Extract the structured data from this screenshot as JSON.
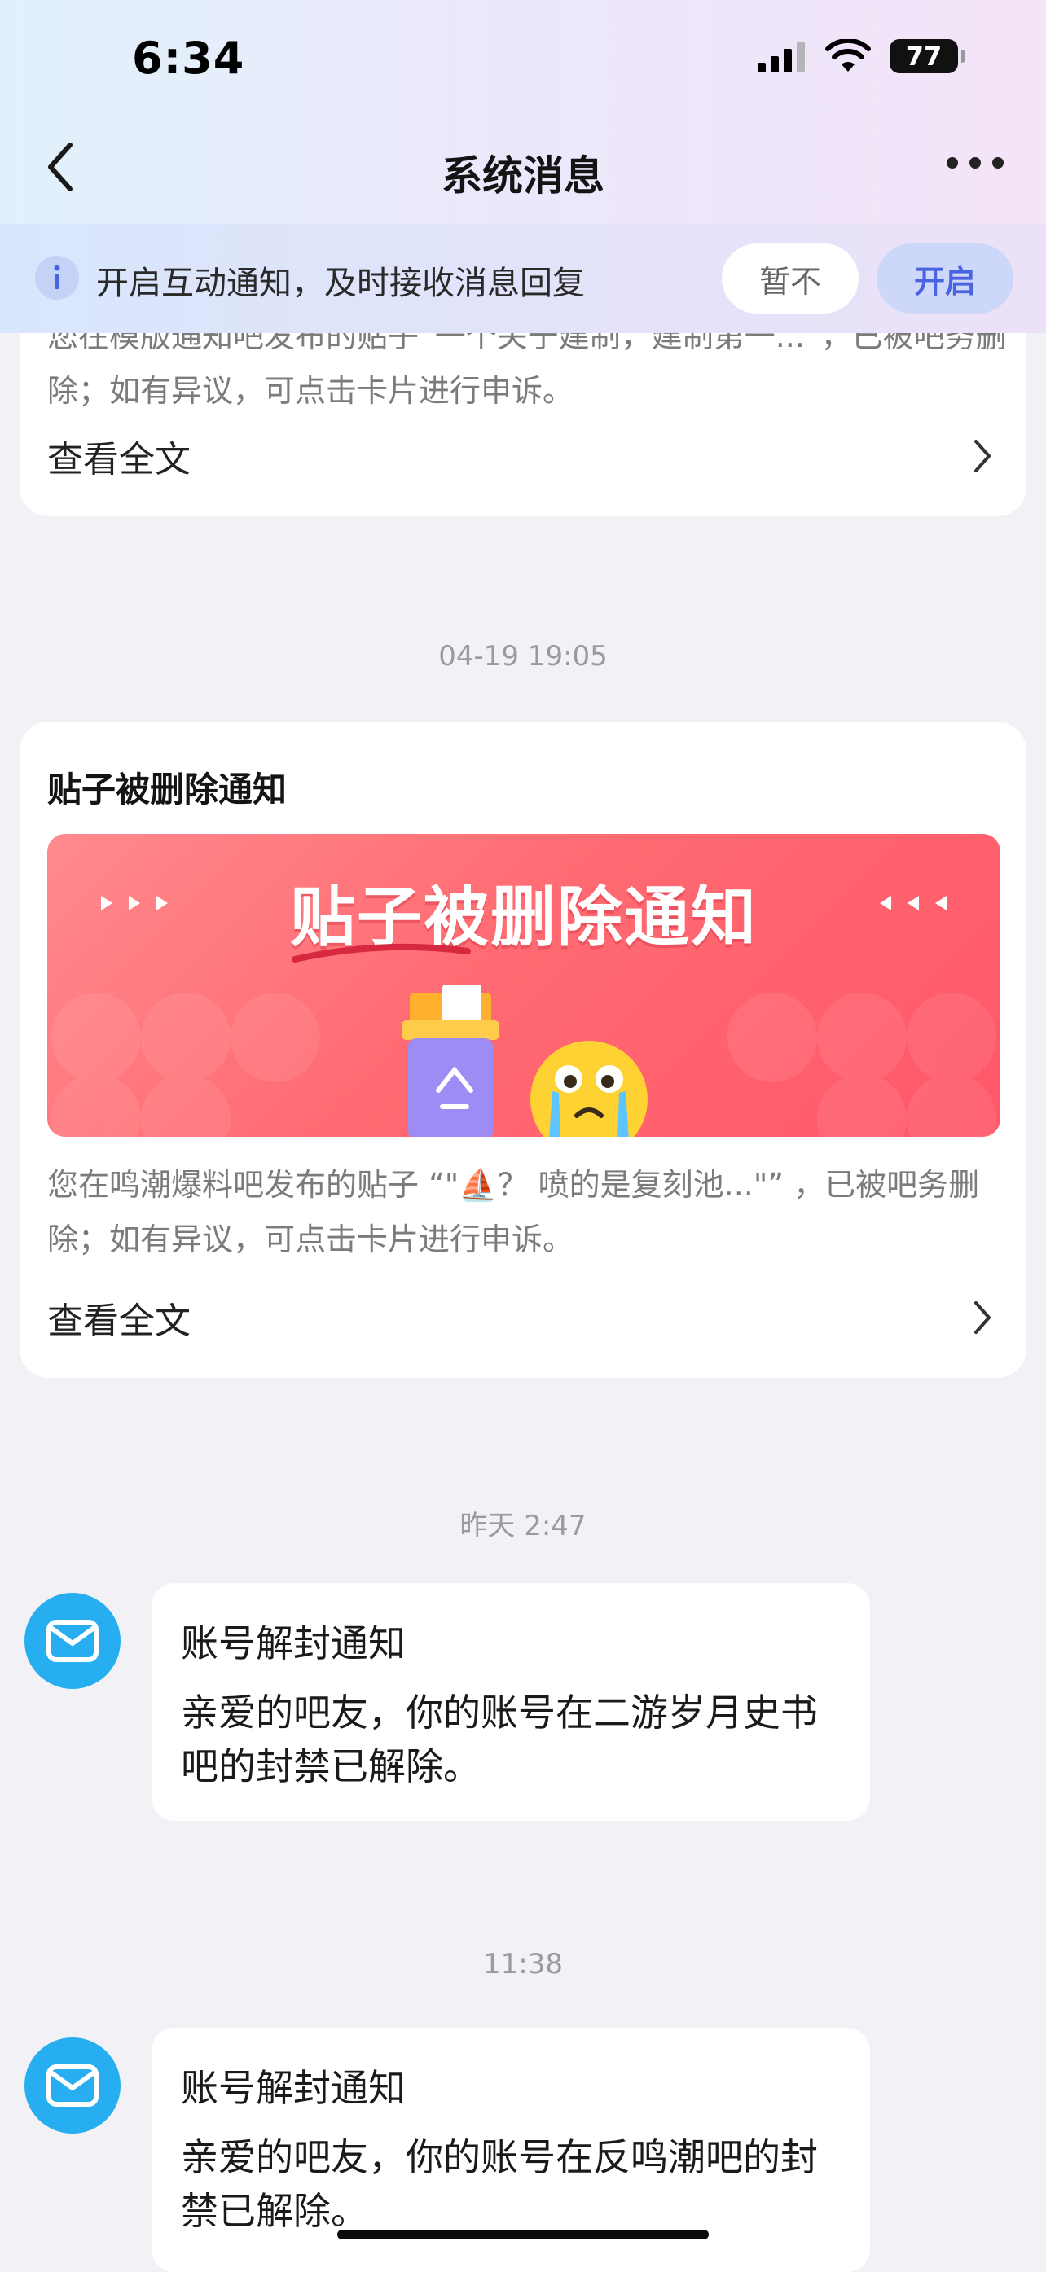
{
  "status_bar": {
    "time": "6:34",
    "battery": "77"
  },
  "nav": {
    "title": "系统消息"
  },
  "notice": {
    "text": "开启互动通知，及时接收消息回复",
    "later_label": "暂不",
    "enable_label": "开启"
  },
  "messages": {
    "card1": {
      "body_partial": "您在模版通知吧发布的贴子“一个关于建制，建制第一...”，已被吧务删除；如有异议，可点击卡片进行申诉。",
      "view_label": "查看全文"
    },
    "ts1": "04-19  19:05",
    "card2": {
      "title": "贴子被删除通知",
      "banner_title": "贴子被删除通知",
      "body": "您在鸣潮爆料吧发布的贴子 “\"⛵？ 喷的是复刻池...\"” ，已被吧务删除；如有异议，可点击卡片进行申诉。",
      "view_label": "查看全文"
    },
    "ts2": "昨天 2:47",
    "msg3": {
      "title": "账号解封通知",
      "body": "亲爱的吧友，你的账号在二游岁月史书吧的封禁已解除。"
    },
    "ts3": "11:38",
    "msg4": {
      "title": "账号解封通知",
      "body": "亲爱的吧友，你的账号在反鸣潮吧的封禁已解除。"
    }
  },
  "colors": {
    "accent": "#4a63e0",
    "avatar": "#27aef0",
    "banner": "#ff6b72"
  },
  "icons": [
    "back-arrow-icon",
    "more-icon",
    "info-icon",
    "chevron-right-icon",
    "mail-icon",
    "recycle-bin-icon",
    "crying-emoji-icon"
  ]
}
